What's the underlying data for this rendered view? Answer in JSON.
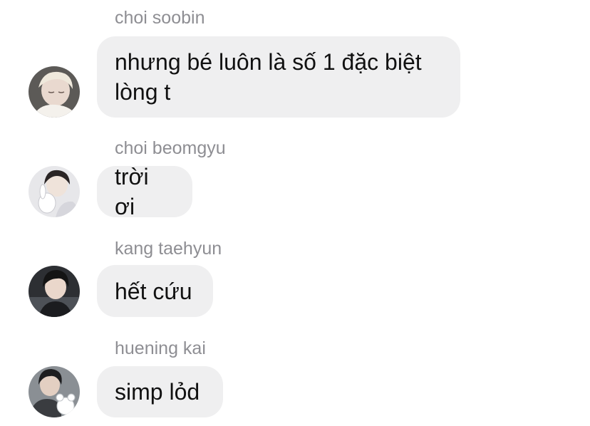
{
  "messages": [
    {
      "sender": "choi soobin",
      "text": "nhưng bé luôn là số 1 đặc biệt lòng t",
      "avatar": "avatar-light-hair-person"
    },
    {
      "sender": "choi beomgyu",
      "text": "trời ơi",
      "avatar": "avatar-person-with-plush"
    },
    {
      "sender": "kang taehyun",
      "text": "hết cứu",
      "avatar": "avatar-dark-hair-person"
    },
    {
      "sender": "huening kai",
      "text": "simp lỏd",
      "avatar": "avatar-person-with-toy"
    }
  ],
  "colors": {
    "bubble": "#efeff0",
    "sender_name": "#8e8e93",
    "message_text": "#111111"
  }
}
